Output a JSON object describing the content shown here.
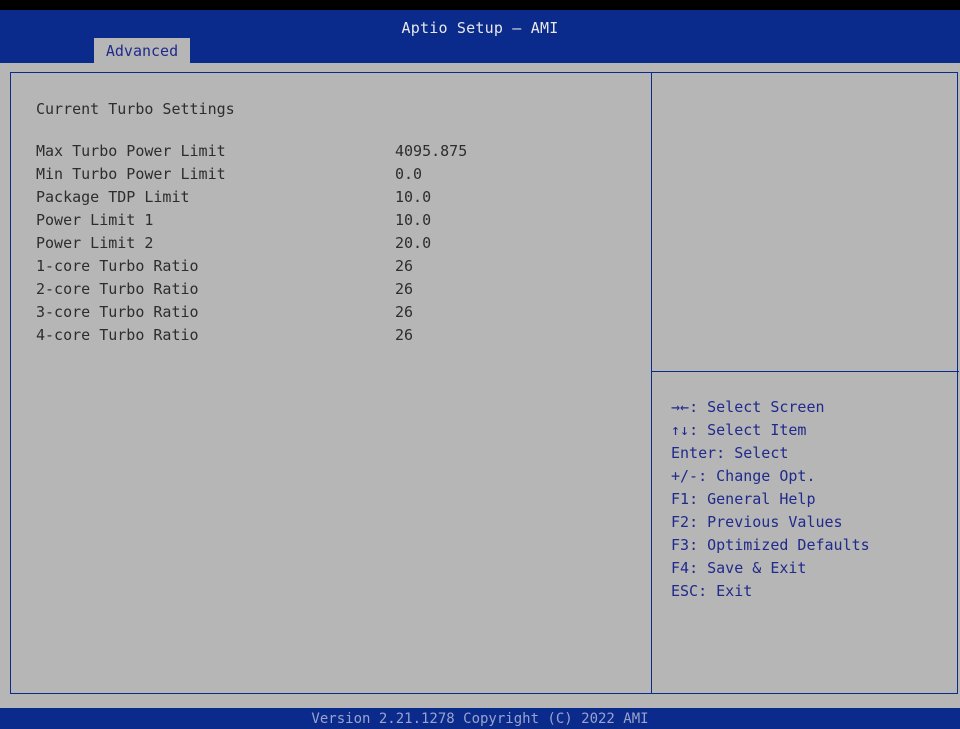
{
  "header": {
    "title": "Aptio Setup – AMI",
    "tabs": [
      {
        "label": "Advanced"
      }
    ]
  },
  "main": {
    "section_title": "Current Turbo Settings",
    "settings": [
      {
        "label": "Max Turbo Power Limit",
        "value": "4095.875"
      },
      {
        "label": "Min Turbo Power Limit",
        "value": "0.0"
      },
      {
        "label": "Package TDP Limit",
        "value": "10.0"
      },
      {
        "label": "Power Limit 1",
        "value": "10.0"
      },
      {
        "label": "Power Limit 2",
        "value": "20.0"
      },
      {
        "label": "1-core Turbo Ratio",
        "value": "26"
      },
      {
        "label": "2-core Turbo Ratio",
        "value": "26"
      },
      {
        "label": "3-core Turbo Ratio",
        "value": "26"
      },
      {
        "label": "4-core Turbo Ratio",
        "value": "26"
      }
    ]
  },
  "help": {
    "items": [
      {
        "key": "→←",
        "text": ": Select Screen",
        "icon": "left-right-arrows-icon"
      },
      {
        "key": "↑↓",
        "text": ": Select Item",
        "icon": "up-down-arrows-icon"
      },
      {
        "key": "Enter",
        "text": ": Select"
      },
      {
        "key": "+/-",
        "text": ": Change Opt."
      },
      {
        "key": "F1",
        "text": ": General Help"
      },
      {
        "key": "F2",
        "text": ": Previous Values"
      },
      {
        "key": "F3",
        "text": ": Optimized Defaults"
      },
      {
        "key": "F4",
        "text": ": Save & Exit"
      },
      {
        "key": "ESC",
        "text": ": Exit"
      }
    ]
  },
  "footer": {
    "text": "Version 2.21.1278 Copyright (C) 2022 AMI"
  },
  "colors": {
    "header_blue": "#0a2a8c",
    "panel_gray": "#b6b6b6",
    "help_text_blue": "#1f2a8c",
    "text_dark": "#2d2d2d",
    "footer_text": "#9aa3c8"
  }
}
